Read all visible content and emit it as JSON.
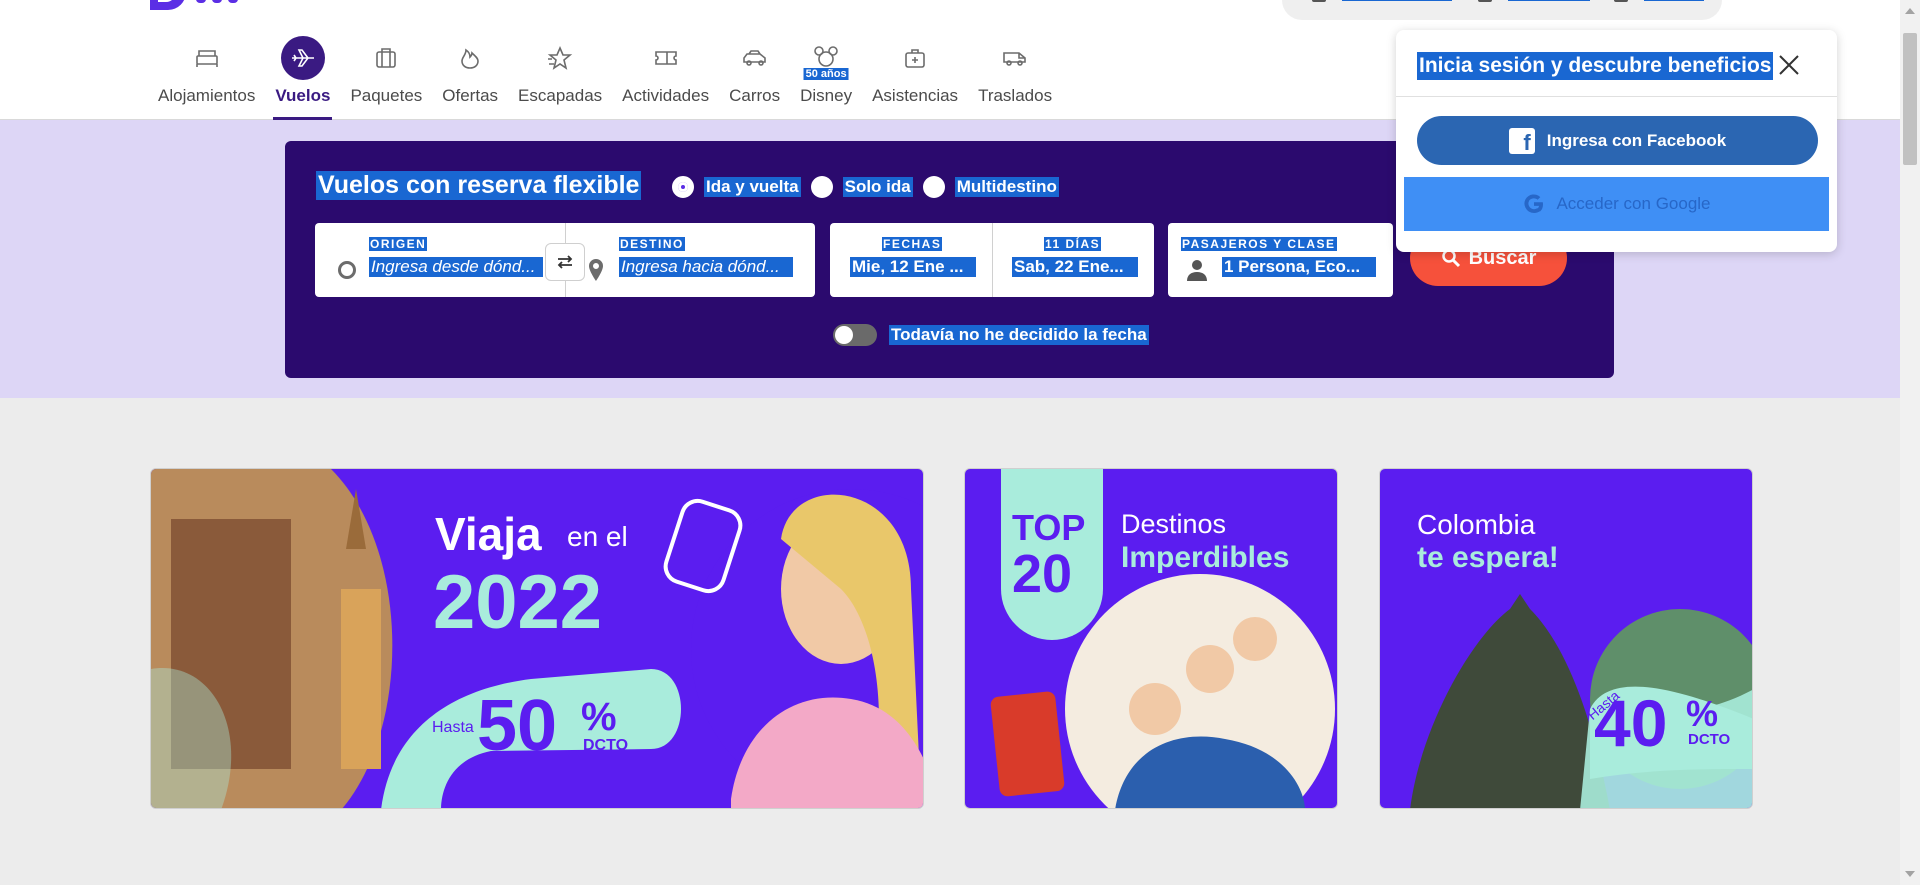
{
  "nav": {
    "items": [
      {
        "label": "Alojamientos",
        "icon": "bed-icon"
      },
      {
        "label": "Vuelos",
        "icon": "plane-icon",
        "active": true
      },
      {
        "label": "Paquetes",
        "icon": "suitcase-icon"
      },
      {
        "label": "Ofertas",
        "icon": "fire-icon"
      },
      {
        "label": "Escapadas",
        "icon": "star-icon"
      },
      {
        "label": "Actividades",
        "icon": "ticket-icon"
      },
      {
        "label": "Carros",
        "icon": "car-icon"
      },
      {
        "label": "Disney",
        "icon": "mickey-icon",
        "badge": "50 años"
      },
      {
        "label": "Asistencias",
        "icon": "medical-kit-icon"
      },
      {
        "label": "Traslados",
        "icon": "van-icon"
      }
    ]
  },
  "search": {
    "title": "Vuelos con reserva flexible",
    "trip_types": [
      "Ida y vuelta",
      "Solo ida",
      "Multidestino"
    ],
    "selected_trip": "Ida y vuelta",
    "origin": {
      "caption": "ORIGEN",
      "placeholder": "Ingresa desde dónd..."
    },
    "destination": {
      "caption": "DESTINO",
      "placeholder": "Ingresa hacia dónd..."
    },
    "dates": {
      "caption": "FECHAS",
      "value": "Mie, 12 Ene ..."
    },
    "duration": {
      "caption": "11 DÍAS",
      "value": "Sab, 22 Ene..."
    },
    "passengers": {
      "caption": "PASAJEROS Y CLASE",
      "value": "1 Persona, Eco..."
    },
    "button": "Buscar",
    "flex_toggle_label": "Todavía no he decidido la fecha",
    "flex_toggle_on": false
  },
  "banners": {
    "b1": {
      "line1": "Viaja",
      "line1b": "en el",
      "year": "2022",
      "hasta": "Hasta",
      "pct": "50",
      "pct_sign": "%",
      "dcto": "DCTO"
    },
    "b2": {
      "top": "TOP",
      "num": "20",
      "line1": "Destinos",
      "line2": "Imperdibles"
    },
    "b3": {
      "line1": "Colombia",
      "line2": "te espera!",
      "hasta": "Hasta",
      "pct": "40",
      "pct_sign": "%",
      "dcto": "DCTO"
    }
  },
  "login_popover": {
    "title": "Inicia sesión y descubre beneficios",
    "facebook": "Ingresa con Facebook",
    "google": "Acceder con Google"
  },
  "colors": {
    "brand_dark": "#2b0a6e",
    "brand_purple": "#5b1df0",
    "accent_orange": "#f6513b",
    "mint": "#a9ecdc",
    "selection": "#1967d2"
  }
}
